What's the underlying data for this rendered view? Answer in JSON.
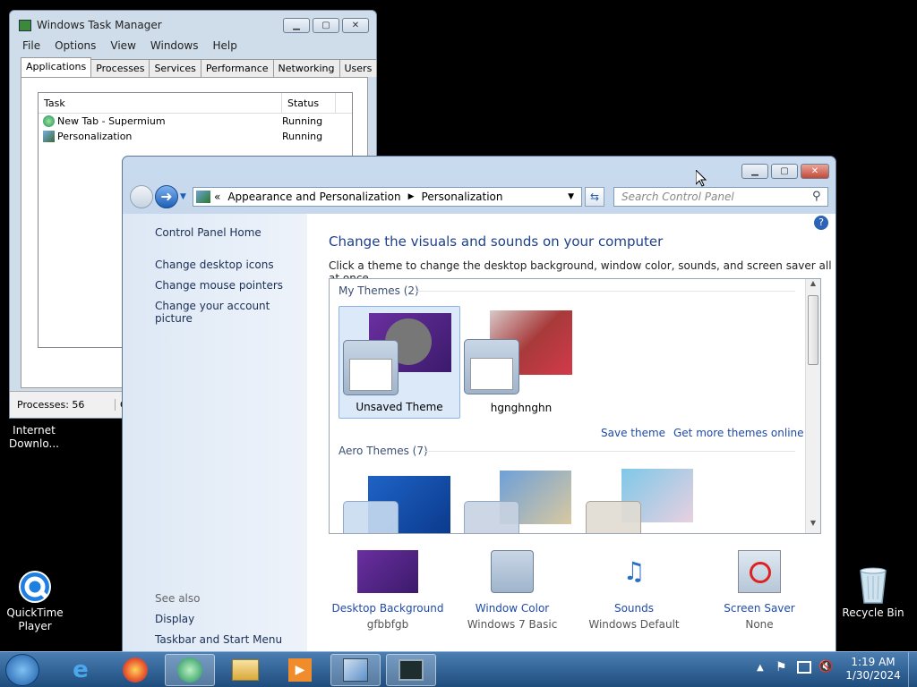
{
  "desktop": {
    "internet_download_label": "Internet\nDownlo...",
    "quicktime_label": "QuickTime Player",
    "recycle_bin_label": "Recycle Bin"
  },
  "task_manager": {
    "title": "Windows Task Manager",
    "menu": [
      "File",
      "Options",
      "View",
      "Windows",
      "Help"
    ],
    "tabs": [
      "Applications",
      "Processes",
      "Services",
      "Performance",
      "Networking",
      "Users"
    ],
    "active_tab": "Applications",
    "columns": [
      "Task",
      "Status"
    ],
    "rows": [
      {
        "task": "New Tab - Supermium",
        "status": "Running"
      },
      {
        "task": "Personalization",
        "status": "Running"
      }
    ],
    "status_processes": "Processes: 56",
    "status_cpu": "C"
  },
  "personalization": {
    "breadcrumb_prefix": "«",
    "breadcrumb": [
      "Appearance and Personalization",
      "Personalization"
    ],
    "search_placeholder": "Search Control Panel",
    "sidebar": {
      "home": "Control Panel Home",
      "links": [
        "Change desktop icons",
        "Change mouse pointers",
        "Change your account picture"
      ],
      "see_also": "See also",
      "see_also_links": [
        "Display",
        "Taskbar and Start Menu"
      ]
    },
    "heading": "Change the visuals and sounds on your computer",
    "subheading": "Click a theme to change the desktop background, window color, sounds, and screen saver all at once.",
    "my_themes_label": "My Themes (2)",
    "my_themes": [
      "Unsaved Theme",
      "hgnghnghn"
    ],
    "save_theme": "Save theme",
    "get_more": "Get more themes online",
    "aero_themes_label": "Aero Themes (7)",
    "bottom": [
      {
        "title": "Desktop Background",
        "sub": "gfbbfgb"
      },
      {
        "title": "Window Color",
        "sub": "Windows 7 Basic"
      },
      {
        "title": "Sounds",
        "sub": "Windows Default"
      },
      {
        "title": "Screen Saver",
        "sub": "None"
      }
    ]
  },
  "taskbar": {
    "time": "1:19 AM",
    "date": "1/30/2024"
  }
}
